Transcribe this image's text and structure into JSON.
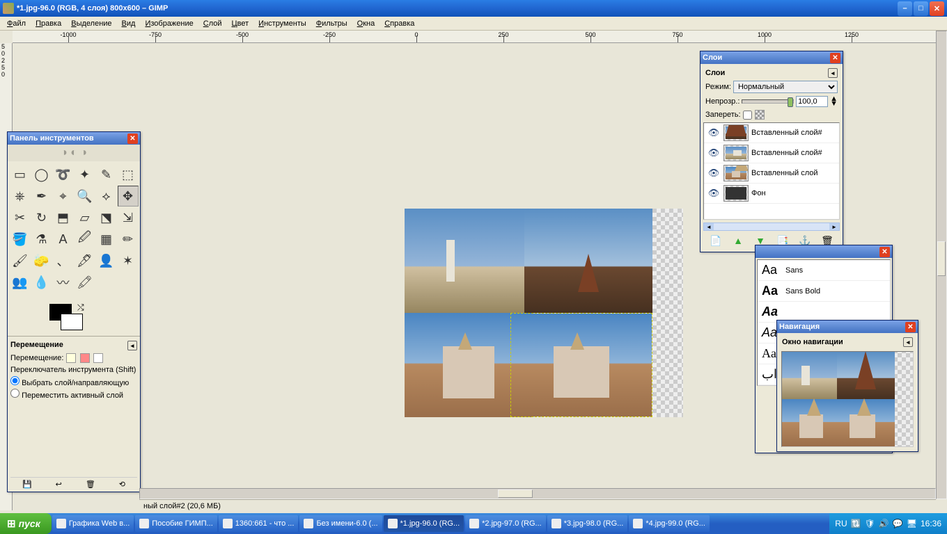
{
  "titlebar": {
    "text": "*1.jpg-96.0 (RGB, 4 слоя) 800x600 – GIMP"
  },
  "menu": [
    "Файл",
    "Правка",
    "Выделение",
    "Вид",
    "Изображение",
    "Слой",
    "Цвет",
    "Инструменты",
    "Фильтры",
    "Окна",
    "Справка"
  ],
  "ruler_h": [
    -1000,
    -750,
    -500,
    -250,
    0,
    250,
    500,
    750,
    1000,
    1250
  ],
  "ruler_v": [
    0,
    250,
    500
  ],
  "toolbox": {
    "title": "Панель инструментов",
    "tools": [
      "▭",
      "◯",
      "➰",
      "✦",
      "✎",
      "⬚",
      "⎈",
      "✒",
      "⌖",
      "🔍",
      "⟡",
      "✥",
      "✂",
      "↻",
      "⬒",
      "▱",
      "⬔",
      "⇲",
      "🪣",
      "⚗",
      "A",
      "🖉",
      "▦",
      "✏",
      "🖌",
      "🧽",
      "、",
      "🖋",
      "👤",
      "✶",
      "👥",
      "💧",
      "〰",
      "🖍"
    ],
    "active_index": 11,
    "opts_title": "Перемещение",
    "opts_row1": "Перемещение:",
    "opts_row2": "Переключатель инструмента  (Shift)",
    "opts_radio1": "Выбрать слой/направляющую",
    "opts_radio2": "Переместить активный слой"
  },
  "layers": {
    "title": "Слои",
    "subtitle": "Слои",
    "mode_label": "Режим:",
    "mode_value": "Нормальный",
    "opacity_label": "Непрозр.:",
    "opacity_value": "100,0",
    "lock_label": "Запереть:",
    "items": [
      {
        "name": "Вставленный слой#"
      },
      {
        "name": "Вставленный слой#"
      },
      {
        "name": "Вставленный слой"
      },
      {
        "name": "Фон"
      }
    ]
  },
  "fonts": {
    "items": [
      {
        "sample": "Aa",
        "name": "Sans"
      },
      {
        "sample": "Aa",
        "name": "Sans Bold"
      },
      {
        "sample": "Aa",
        "name": ""
      },
      {
        "sample": "Aa",
        "name": ""
      },
      {
        "sample": "Aa",
        "name": ""
      },
      {
        "sample": "اب",
        "name": ""
      }
    ]
  },
  "navigation": {
    "title": "Навигация",
    "subtitle": "Окно навигации"
  },
  "status": "ный слой#2 (20,6 МБ)",
  "taskbar": {
    "start": "пуск",
    "items": [
      {
        "label": "Графика Web в..."
      },
      {
        "label": "Пособие ГИМП..."
      },
      {
        "label": "1360:661 - что ..."
      },
      {
        "label": "Без имени-6.0 (..."
      },
      {
        "label": "*1.jpg-96.0 (RG...",
        "active": true
      },
      {
        "label": "*2.jpg-97.0 (RG..."
      },
      {
        "label": "*3.jpg-98.0 (RG..."
      },
      {
        "label": "*4.jpg-99.0 (RG..."
      }
    ],
    "lang": "RU",
    "clock": "16:36"
  }
}
